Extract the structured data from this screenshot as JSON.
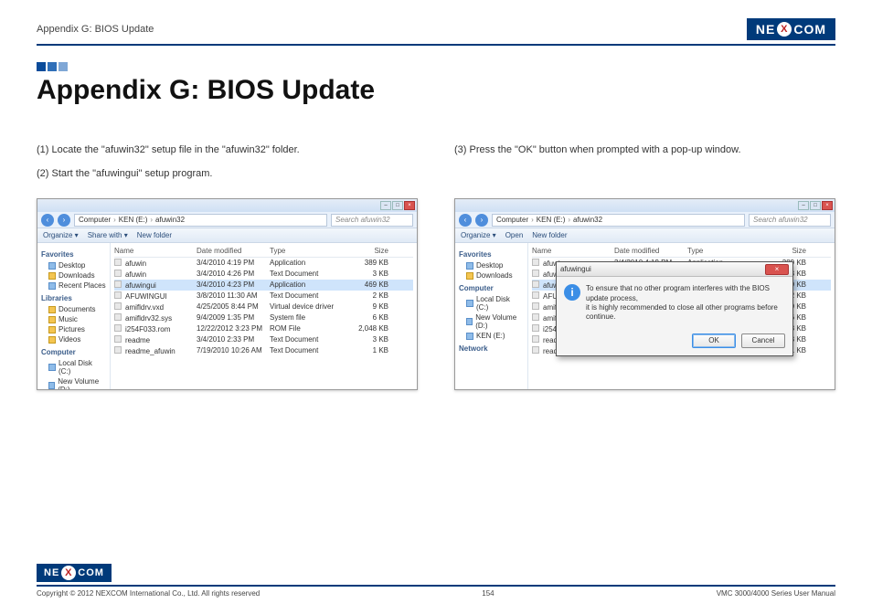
{
  "header": {
    "section": "Appendix G: BIOS Update"
  },
  "logo": {
    "pre": "NE",
    "x": "X",
    "post": "COM"
  },
  "title": "Appendix G: BIOS Update",
  "instructions": {
    "i1": "(1) Locate the \"afuwin32\" setup file in the \"afuwin32\" folder.",
    "i2": "(2) Start the \"afuwingui\" setup program.",
    "i3": "(3) Press the \"OK\" button when prompted with a pop-up window."
  },
  "explorer": {
    "breadcrumb": {
      "b1": "Computer",
      "b2": "KEN (E:)",
      "b3": "afuwin32"
    },
    "search_placeholder": "Search afuwin32",
    "toolbar": {
      "organize": "Organize ▾",
      "share": "Share with ▾",
      "open": "Open",
      "newfolder": "New folder"
    },
    "side": {
      "favorites": "Favorites",
      "desktop": "Desktop",
      "downloads": "Downloads",
      "recent": "Recent Places",
      "libraries": "Libraries",
      "documents": "Documents",
      "music": "Music",
      "pictures": "Pictures",
      "videos": "Videos",
      "computer": "Computer",
      "localc": "Local Disk (C:)",
      "newvold": "New Volume (D:)",
      "kene": "KEN (E:)",
      "network": "Network"
    },
    "cols": {
      "name": "Name",
      "date": "Date modified",
      "type": "Type",
      "size": "Size"
    },
    "rows": [
      {
        "name": "afuwin",
        "date": "3/4/2010 4:19 PM",
        "type": "Application",
        "size": "389 KB"
      },
      {
        "name": "afuwin",
        "date": "3/4/2010 4:26 PM",
        "type": "Text Document",
        "size": "3 KB"
      },
      {
        "name": "afuwingui",
        "date": "3/4/2010 4:23 PM",
        "type": "Application",
        "size": "469 KB"
      },
      {
        "name": "AFUWINGUI",
        "date": "3/8/2010 11:30 AM",
        "type": "Text Document",
        "size": "2 KB"
      },
      {
        "name": "amifldrv.vxd",
        "date": "4/25/2005 8:44 PM",
        "type": "Virtual device driver",
        "size": "9 KB"
      },
      {
        "name": "amifldrv32.sys",
        "date": "9/4/2009 1:35 PM",
        "type": "System file",
        "size": "6 KB"
      },
      {
        "name": "i254F033.rom",
        "date": "12/22/2012 3:23 PM",
        "type": "ROM File",
        "size": "2,048 KB"
      },
      {
        "name": "readme",
        "date": "3/4/2010 2:33 PM",
        "type": "Text Document",
        "size": "3 KB"
      },
      {
        "name": "readme_afuwin",
        "date": "7/19/2010 10:26 AM",
        "type": "Text Document",
        "size": "1 KB"
      }
    ]
  },
  "dialog": {
    "title": "afuwingui",
    "line1": "To ensure that no other program interferes with the BIOS update process,",
    "line2": "it is highly recommended to close all other programs before continue.",
    "ok": "OK",
    "cancel": "Cancel"
  },
  "footer": {
    "copyright": "Copyright © 2012 NEXCOM International Co., Ltd. All rights reserved",
    "page": "154",
    "manual": "VMC 3000/4000 Series User Manual"
  }
}
